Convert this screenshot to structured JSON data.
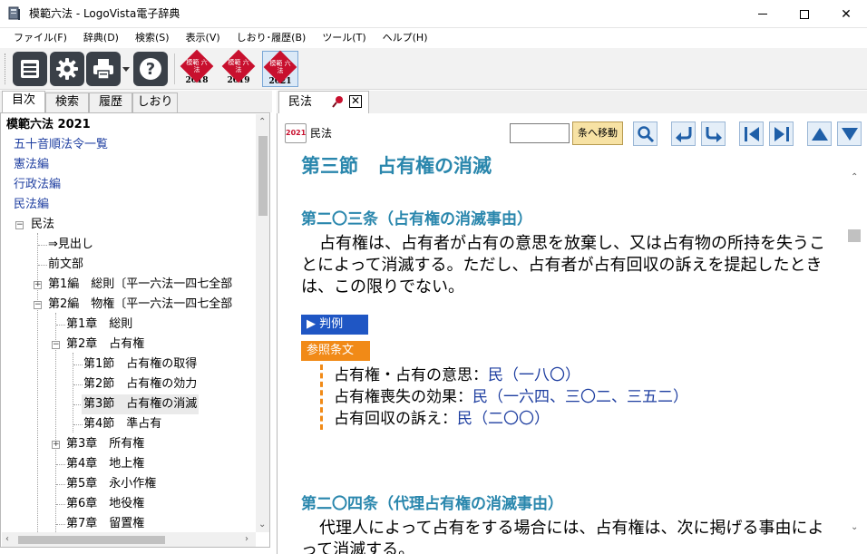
{
  "window": {
    "title": "模範六法 - LogoVista電子辞典",
    "minimize": "",
    "maximize": "",
    "close": "✕"
  },
  "menu": [
    "ファイル(F)",
    "辞典(D)",
    "検索(S)",
    "表示(V)",
    "しおり･履歴(B)",
    "ツール(T)",
    "ヘルプ(H)"
  ],
  "toolbar": {
    "editions": [
      {
        "icon": "模範 六法",
        "year": "2018"
      },
      {
        "icon": "模範 六法",
        "year": "2019"
      },
      {
        "icon": "模範 六法",
        "year": "2021"
      }
    ]
  },
  "left_tabs": [
    "目次",
    "検索",
    "履歴",
    "しおり"
  ],
  "tree": [
    {
      "text": "模範六法 2021",
      "level": 0,
      "style": "bold"
    },
    {
      "text": "五十音順法令一覧",
      "level": 0,
      "style": "link"
    },
    {
      "text": "憲法編",
      "level": 0,
      "style": "link"
    },
    {
      "text": "行政法編",
      "level": 0,
      "style": "link"
    },
    {
      "text": "民法編",
      "level": 0,
      "style": "link"
    },
    {
      "text": "民法",
      "level": 1,
      "style": "plain",
      "toggle": "−"
    },
    {
      "text": "⇒見出し",
      "level": 2,
      "style": "plain"
    },
    {
      "text": "前文部",
      "level": 2,
      "style": "plain"
    },
    {
      "text": "第1編　総則〔平一六法一四七全部",
      "level": 2,
      "style": "plain",
      "toggle": "+"
    },
    {
      "text": "第2編　物権〔平一六法一四七全部",
      "level": 2,
      "style": "plain",
      "toggle": "−"
    },
    {
      "text": "第1章　総則",
      "level": 3,
      "style": "plain"
    },
    {
      "text": "第2章　占有権",
      "level": 3,
      "style": "plain",
      "toggle": "−"
    },
    {
      "text": "第1節　占有権の取得",
      "level": 4,
      "style": "plain"
    },
    {
      "text": "第2節　占有権の効力",
      "level": 4,
      "style": "plain"
    },
    {
      "text": "第3節　占有権の消滅",
      "level": 4,
      "style": "plain",
      "selected": true
    },
    {
      "text": "第4節　準占有",
      "level": 4,
      "style": "plain"
    },
    {
      "text": "第3章　所有権",
      "level": 3,
      "style": "plain",
      "toggle": "+"
    },
    {
      "text": "第4章　地上権",
      "level": 3,
      "style": "plain"
    },
    {
      "text": "第5章　永小作権",
      "level": 3,
      "style": "plain"
    },
    {
      "text": "第6章　地役権",
      "level": 3,
      "style": "plain"
    },
    {
      "text": "第7章　留置権",
      "level": 3,
      "style": "plain"
    }
  ],
  "doc_tab": {
    "label": "民法",
    "close": "✕"
  },
  "doc_toolbar": {
    "badge": "2021",
    "book": "民法",
    "jump_value": "",
    "jump_button": "条へ移動"
  },
  "content": {
    "section_title": "第三節　占有権の消滅",
    "article1_title": "第二〇三条（占有権の消滅事由）",
    "article1_text": "占有権は、占有者が占有の意思を放棄し、又は占有物の所持を失うことによって消滅する。ただし、占有者が占有回収の訴えを提起したときは、この限りでない。",
    "case_button": "▶ 判例",
    "ref_button": "参照条文",
    "refs": [
      {
        "label": "占有権・占有の意思：",
        "link": "民（一八〇）"
      },
      {
        "label": "占有権喪失の効果：",
        "link": "民（一六四、三〇二、三五二）"
      },
      {
        "label": "占有回収の訴え：",
        "link": "民（二〇〇）"
      }
    ],
    "article2_title": "第二〇四条（代理占有権の消滅事由）",
    "article2_text": "代理人によって占有をする場合には、占有権は、次に掲げる事由によって消滅する。"
  },
  "colors": {
    "heading": "#2a87ad",
    "link": "#1e3ea0",
    "case_btn": "#1f56c4",
    "ref_btn": "#f18a17",
    "edition_red": "#c8102e"
  }
}
